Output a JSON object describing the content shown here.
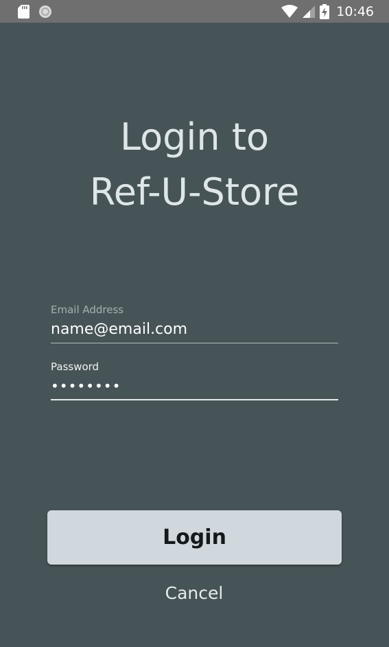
{
  "status_bar": {
    "time": "10:46",
    "icons": [
      "sd-card-icon",
      "sync-icon",
      "wifi-icon",
      "cell-signal-icon",
      "battery-charging-icon"
    ],
    "text_color": "#ffffff",
    "background": "#6f6f6f"
  },
  "login": {
    "title_line1": "Login to",
    "title_line2": "Ref-U-Store",
    "email": {
      "label": "Email Address",
      "value": "name@email.com"
    },
    "password": {
      "label": "Password",
      "value": "••••••••"
    },
    "login_button_label": "Login",
    "cancel_button_label": "Cancel"
  },
  "colors": {
    "background": "#475457",
    "button_background": "#d0d8de",
    "title": "#dfe6e8"
  }
}
